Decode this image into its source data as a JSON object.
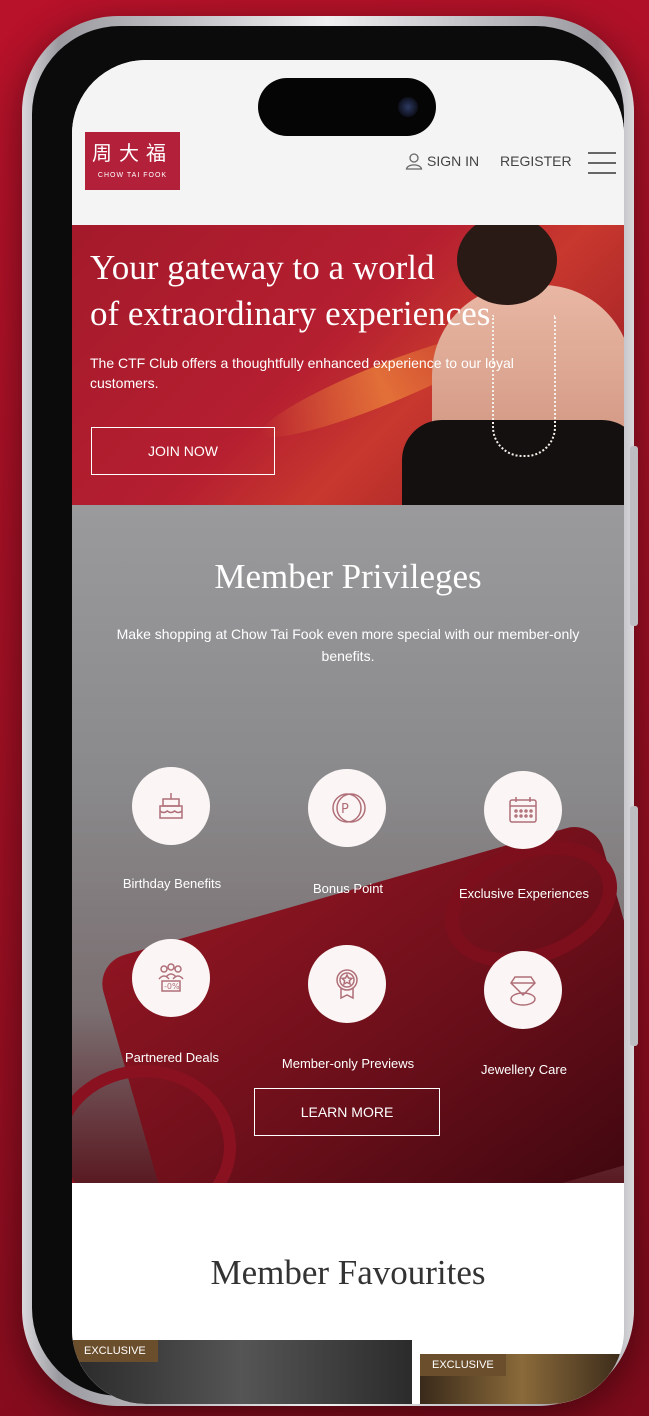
{
  "header": {
    "logo_zh": "周大福",
    "logo_en": "CHOW TAI FOOK",
    "sign_in": "SIGN IN",
    "register": "REGISTER"
  },
  "hero": {
    "title_line1": "Your gateway to a world",
    "title_line2": "of extraordinary experiences",
    "subtitle": "The CTF Club offers a thoughtfully enhanced experience to our loyal customers.",
    "cta": "JOIN NOW"
  },
  "privileges": {
    "title": "Member Privileges",
    "subtitle": "Make shopping at Chow Tai Fook even more special with our member-only benefits.",
    "items": [
      {
        "label": "Birthday Benefits",
        "icon": "birthday-cake-icon"
      },
      {
        "label": "Bonus Point",
        "icon": "points-coin-icon"
      },
      {
        "label": "Exclusive Experiences",
        "icon": "calendar-icon"
      },
      {
        "label": "Partnered Deals",
        "icon": "partner-discount-icon"
      },
      {
        "label": "Member-only Previews",
        "icon": "star-badge-icon"
      },
      {
        "label": "Jewellery Care",
        "icon": "diamond-ring-icon"
      }
    ],
    "cta": "LEARN MORE"
  },
  "favourites": {
    "title": "Member Favourites",
    "tag1": "EXCLUSIVE",
    "tag2": "EXCLUSIVE"
  },
  "colors": {
    "brand_red": "#b3203a",
    "background_red": "#a8112a"
  }
}
